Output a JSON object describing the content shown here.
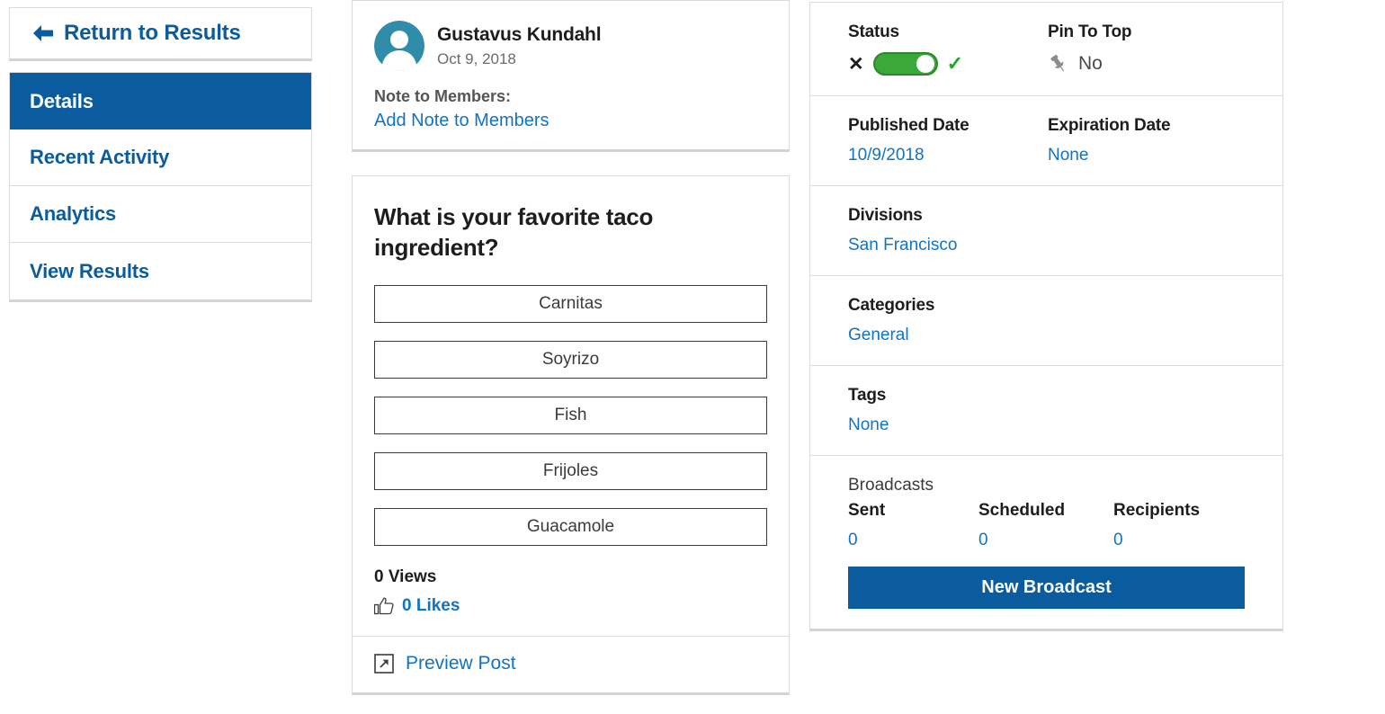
{
  "sidebar": {
    "return_label": "Return to Results",
    "back_icon": "arrow-left-icon",
    "items": [
      {
        "label": "Details",
        "active": true
      },
      {
        "label": "Recent Activity",
        "active": false
      },
      {
        "label": "Analytics",
        "active": false
      },
      {
        "label": "View Results",
        "active": false
      }
    ]
  },
  "author": {
    "avatar_icon": "user-avatar-icon",
    "avatar_bg": "#2f8daa",
    "name": "Gustavus Kundahl",
    "date": "Oct 9, 2018",
    "note_label": "Note to Members:",
    "note_link": "Add Note to Members"
  },
  "poll": {
    "question": "What is your favorite taco ingredient?",
    "options": [
      "Carnitas",
      "Soyrizo",
      "Fish",
      "Frijoles",
      "Guacamole"
    ],
    "views": "0 Views",
    "likes": "0 Likes",
    "likes_icon": "thumbs-up-icon",
    "preview_label": "Preview Post",
    "preview_icon": "external-link-icon"
  },
  "details": {
    "status_label": "Status",
    "status_off_icon": "x-icon",
    "status_on_icon": "check-icon",
    "status_toggle_state": "on",
    "pin_label": "Pin To Top",
    "pin_icon": "pushpin-icon",
    "pin_value": "No",
    "published_label": "Published Date",
    "published_value": "10/9/2018",
    "expiration_label": "Expiration Date",
    "expiration_value": "None",
    "divisions_label": "Divisions",
    "divisions_value": "San Francisco",
    "categories_label": "Categories",
    "categories_value": "General",
    "tags_label": "Tags",
    "tags_value": "None"
  },
  "broadcasts": {
    "title": "Broadcasts",
    "sent_label": "Sent",
    "sent_value": "0",
    "scheduled_label": "Scheduled",
    "scheduled_value": "0",
    "recipients_label": "Recipients",
    "recipients_value": "0",
    "new_button": "New Broadcast"
  },
  "colors": {
    "brand_blue": "#0a5c9e",
    "link_blue": "#1273c4",
    "toggle_green": "#3aa93a",
    "avatar_teal": "#2f8daa"
  }
}
